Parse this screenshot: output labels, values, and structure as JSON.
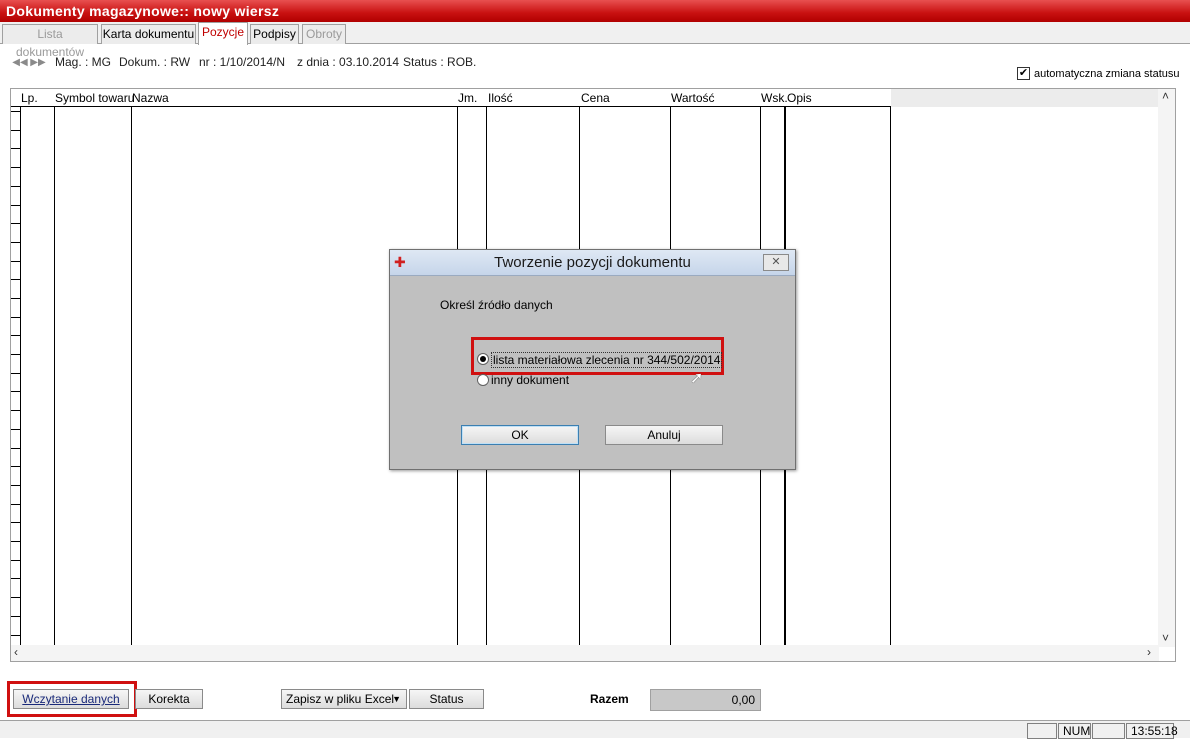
{
  "window": {
    "title": "Dokumenty magazynowe:: nowy wiersz"
  },
  "tabs": [
    {
      "label": "Lista dokumentów",
      "state": "disabled"
    },
    {
      "label": "Karta dokumentu",
      "state": "normal"
    },
    {
      "label": "Pozycje",
      "state": "active"
    },
    {
      "label": "Podpisy",
      "state": "normal"
    },
    {
      "label": "Obroty",
      "state": "disabled"
    }
  ],
  "info": {
    "mag": "Mag. : MG",
    "dokum": "Dokum. : RW",
    "nr": "nr : 1/10/2014/N",
    "date": "z dnia : 03.10.2014",
    "status": "Status : ROB."
  },
  "auto_status": {
    "label": "automatyczna zmiana statusu",
    "checked": true
  },
  "grid": {
    "columns": [
      "Lp.",
      "Symbol towaru",
      "Nazwa",
      "Jm.",
      "Ilość",
      "Cena",
      "Wartość",
      "Wsk.",
      "Opis"
    ]
  },
  "buttons": {
    "load": "Wczytanie danych",
    "correction": "Korekta",
    "excel": "Zapisz w pliku Excel",
    "status": "Status"
  },
  "total": {
    "label": "Razem",
    "value": "0,00"
  },
  "statusbar": {
    "num": "NUM",
    "time": "13:55:18"
  },
  "dialog": {
    "title": "Tworzenie pozycji dokumentu",
    "prompt": "Określ źródło danych",
    "options": [
      {
        "label": "lista materiałowa zlecenia nr 344/502/2014",
        "selected": true
      },
      {
        "label": "inny dokument",
        "selected": false
      }
    ],
    "ok": "OK",
    "cancel": "Anuluj"
  },
  "colors": {
    "title_red": "#c81010",
    "highlight_red": "#d01010",
    "active_tab_text": "#c00000"
  }
}
